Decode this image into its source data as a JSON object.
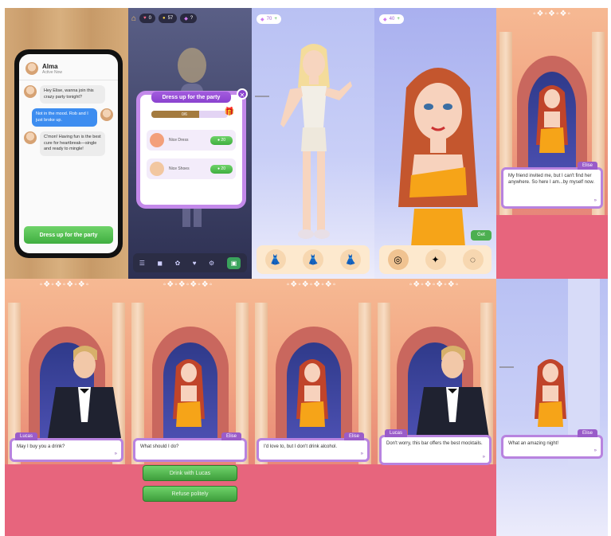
{
  "phone_chat": {
    "contact_name": "Alma",
    "contact_status": "Active Now",
    "messages": [
      {
        "side": "in",
        "text": "Hey Elise, wanna join this crazy party tonight?"
      },
      {
        "side": "out",
        "text": "Not in the mood. Rob and I just broke up."
      },
      {
        "side": "in",
        "text": "C'mon! Having fun is the best cure for heartbreak—single and ready to mingle!"
      }
    ],
    "cta": "Dress up for the party"
  },
  "dressup_popup": {
    "hud": {
      "counter1": "0",
      "counter2": "57",
      "counter3": "?"
    },
    "title": "Dress up for the party",
    "progress": {
      "label": "0/6",
      "fraction": 0.62
    },
    "items": [
      {
        "name": "Nice Dress",
        "price": "20"
      },
      {
        "name": "Nice Shoes",
        "price": "20"
      }
    ]
  },
  "wardrobe1": {
    "coins": "70"
  },
  "wardrobe2": {
    "coins": "40",
    "get_label": "Get"
  },
  "dialogues": [
    {
      "speaker": "Elise",
      "side": "right",
      "text": "My friend invited me, but I can't find her anywhere. So here I am...by myself now."
    },
    {
      "speaker": "Lucas",
      "side": "left",
      "text": "May I buy you a drink?"
    },
    {
      "speaker": "Elise",
      "side": "right",
      "text": "What should I do?"
    },
    {
      "speaker": "Elise",
      "side": "right",
      "text": "I'd love to, but I don't drink alcohol."
    },
    {
      "speaker": "Lucas",
      "side": "left",
      "text": "Don't worry, this bar offers the best mocktails."
    },
    {
      "speaker": "Elise",
      "side": "right",
      "text": "What an amazing night!"
    }
  ],
  "choices": [
    "Drink with Lucas",
    "Refuse politely"
  ],
  "next_symbol": "»"
}
